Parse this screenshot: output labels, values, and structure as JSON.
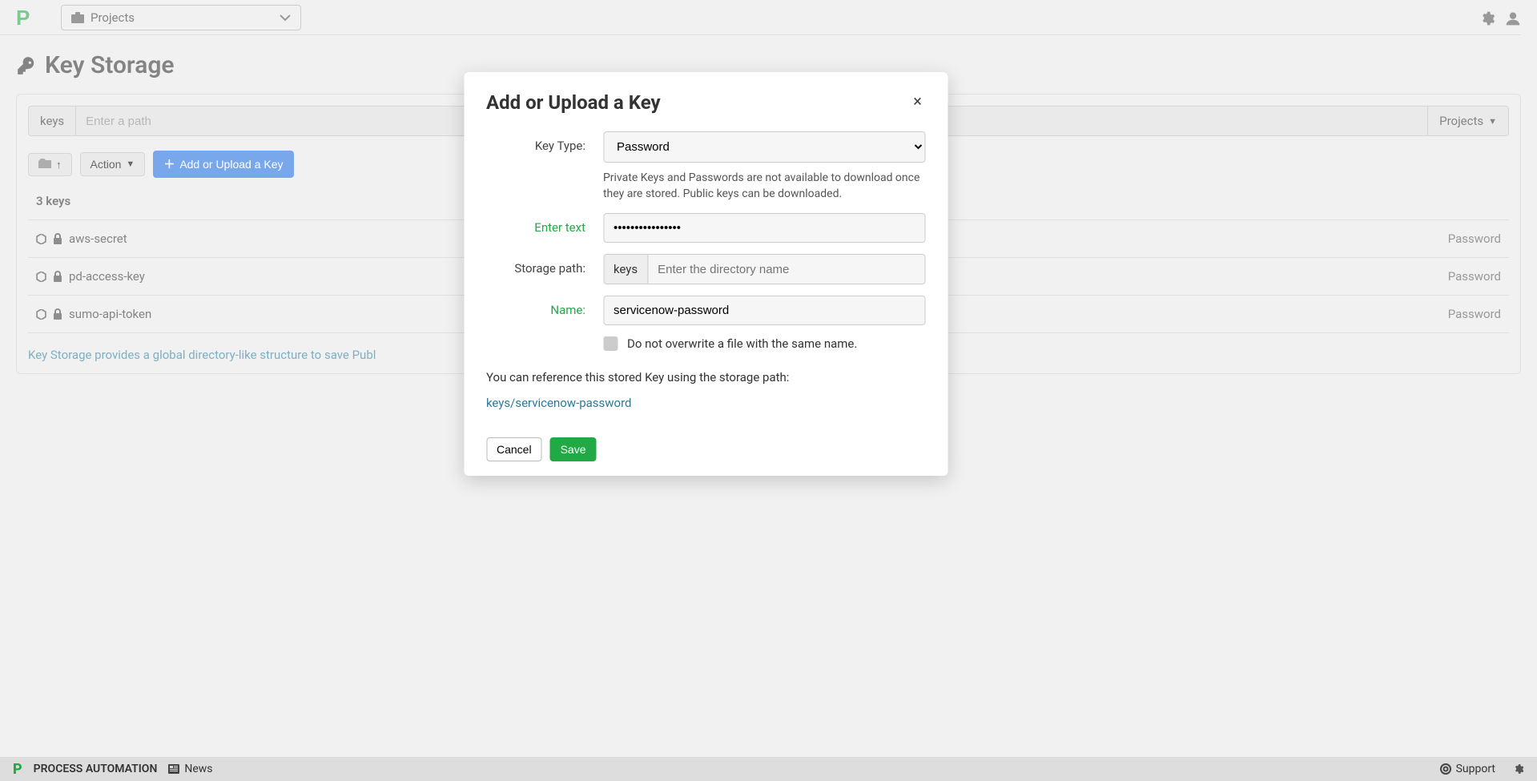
{
  "topbar": {
    "project_label": "Projects",
    "icons": {
      "gear": "gear-icon",
      "user": "user-icon"
    }
  },
  "page": {
    "title": "Key Storage"
  },
  "path_bar": {
    "prefix": "keys",
    "placeholder": "Enter a path",
    "projects_label": "Projects"
  },
  "toolbar": {
    "action_label": "Action",
    "add_label": "Add or Upload a Key"
  },
  "key_list": {
    "count_label": "3 keys",
    "items": [
      {
        "name": "aws-secret",
        "type": "Password"
      },
      {
        "name": "pd-access-key",
        "type": "Password"
      },
      {
        "name": "sumo-api-token",
        "type": "Password"
      }
    ],
    "footer_note": "Key Storage provides a global directory-like structure to save Publ"
  },
  "modal": {
    "title": "Add or Upload a Key",
    "labels": {
      "key_type": "Key Type:",
      "enter_text": "Enter text",
      "storage_path": "Storage path:",
      "name": "Name:"
    },
    "key_type_value": "Password",
    "helper": "Private Keys and Passwords are not available to download once they are stored. Public keys can be downloaded.",
    "password_value": "••••••••••••••••",
    "storage_prefix": "keys",
    "storage_placeholder": "Enter the directory name",
    "name_value": "servicenow-password",
    "overwrite_label": "Do not overwrite a file with the same name.",
    "reference_label": "You can reference this stored Key using the storage path:",
    "reference_path": "keys/servicenow-password",
    "cancel_label": "Cancel",
    "save_label": "Save"
  },
  "bottombar": {
    "brand": "PROCESS AUTOMATION",
    "news_label": "News",
    "support_label": "Support"
  }
}
